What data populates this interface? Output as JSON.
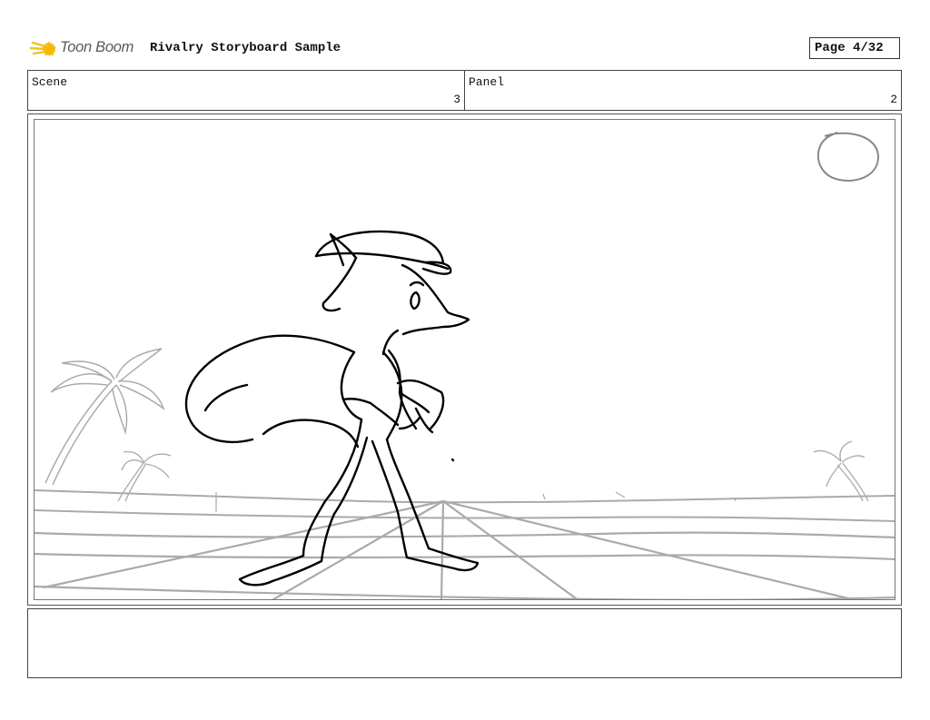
{
  "header": {
    "logo_text": "Toon Boom",
    "document_title": "Rivalry Storyboard Sample",
    "page_indicator": "Page  4/32"
  },
  "info": {
    "scene_label": "Scene",
    "scene_value": "3",
    "panel_label": "Panel",
    "panel_value": "2"
  },
  "drawing": {
    "subject": "fox character in cap walking on beach",
    "elements": [
      "sun-sketch",
      "palm-tree-left",
      "small-palm-left",
      "small-palm-right",
      "horizon-line",
      "ground-perspective-lines",
      "fox-character"
    ]
  },
  "notes": {
    "text": ""
  },
  "colors": {
    "logo_star": "#f2c21b",
    "logo_text": "#5a5a5a",
    "sketch_primary": "#000000",
    "sketch_secondary": "#aaaaaa"
  }
}
